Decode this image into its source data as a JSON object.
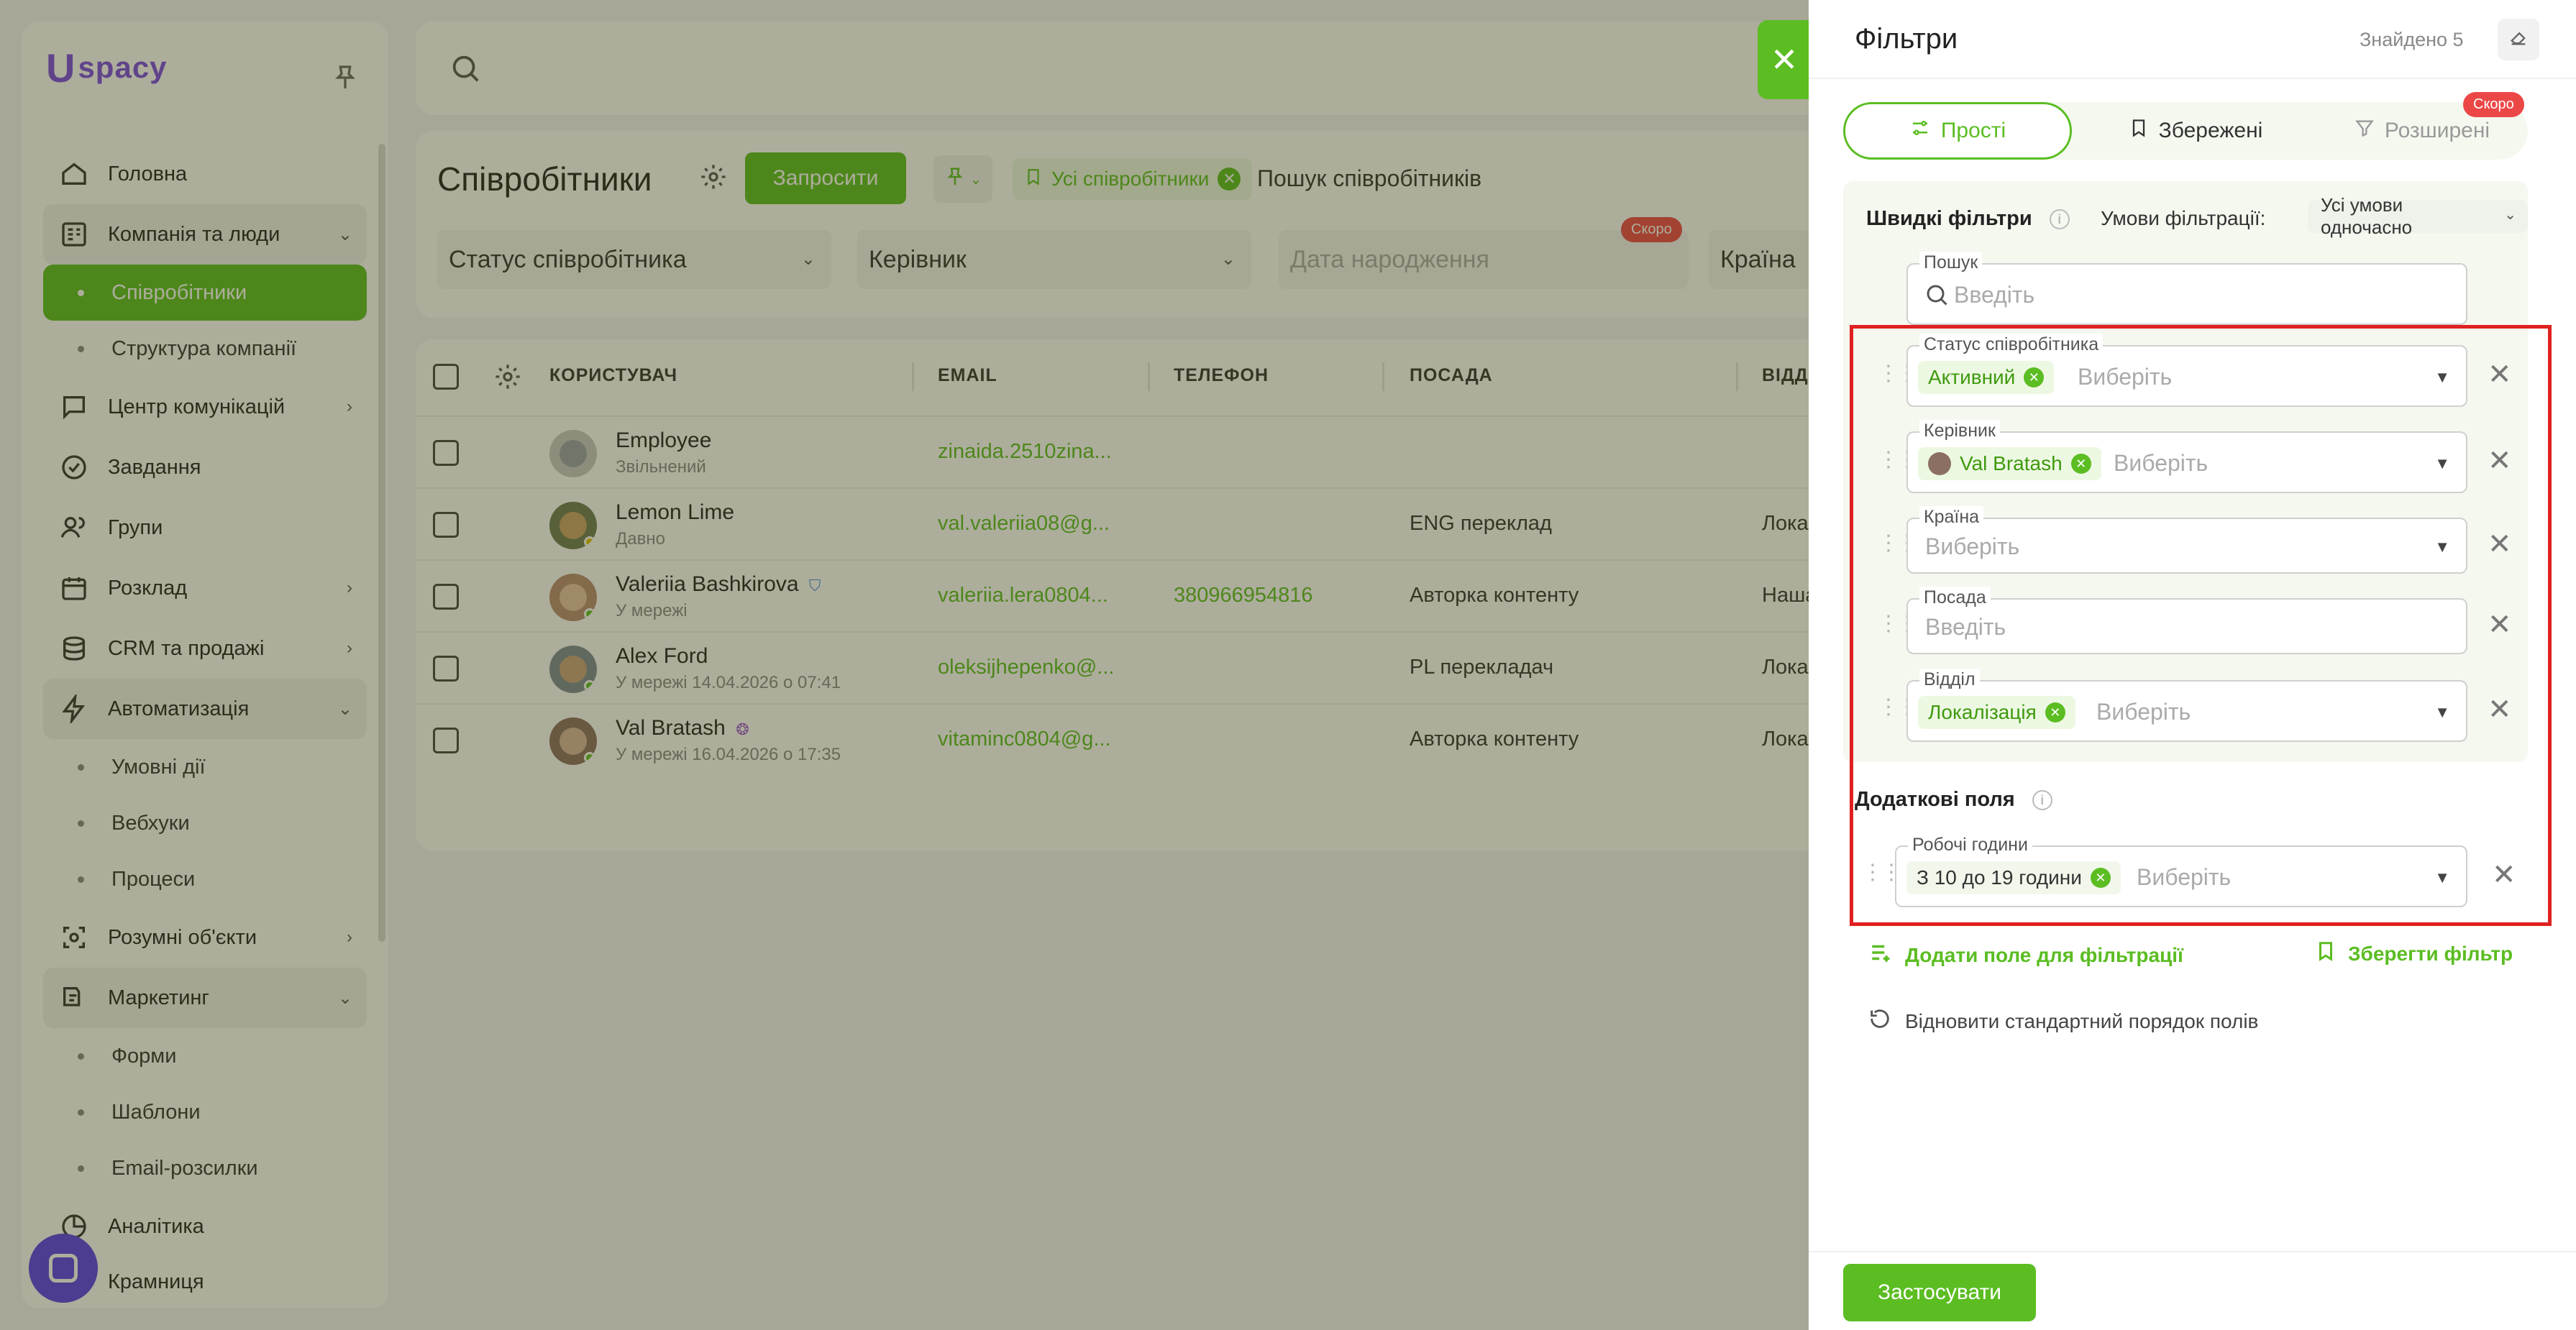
{
  "sidebar": {
    "logo_letter": "U",
    "logo_text": "spacy",
    "items": [
      {
        "label": "Головна",
        "icon": "home-icon"
      },
      {
        "label": "Компанія та люди",
        "icon": "building-icon",
        "chevron": "⌄"
      },
      {
        "label": "Співробітники",
        "sub": true,
        "active": true
      },
      {
        "label": "Структура компанії",
        "sub": true
      },
      {
        "label": "Центр комунікацій",
        "icon": "chat-icon",
        "chevron": "›"
      },
      {
        "label": "Завдання",
        "icon": "check-circle-icon"
      },
      {
        "label": "Групи",
        "icon": "users-icon"
      },
      {
        "label": "Розклад",
        "icon": "calendar-icon",
        "chevron": "›"
      },
      {
        "label": "CRM та продажі",
        "icon": "database-icon",
        "chevron": "›"
      },
      {
        "label": "Автоматизація",
        "icon": "bolt-icon",
        "chevron": "⌄"
      },
      {
        "label": "Умовні дії",
        "sub": true
      },
      {
        "label": "Вебхуки",
        "sub": true
      },
      {
        "label": "Процеси",
        "sub": true
      },
      {
        "label": "Розумні об'єкти",
        "icon": "scan-icon",
        "chevron": "›"
      },
      {
        "label": "Маркетинг",
        "icon": "megaphone-icon",
        "chevron": "⌄"
      },
      {
        "label": "Форми",
        "sub": true
      },
      {
        "label": "Шаблони",
        "sub": true
      },
      {
        "label": "Email-розсилки",
        "sub": true
      },
      {
        "label": "Аналітика",
        "icon": "chart-icon"
      },
      {
        "label": "Крамниця",
        "icon": "shop-icon"
      }
    ]
  },
  "header": {
    "page_title": "Співробітники",
    "invite_label": "Запросити",
    "chip_all": "Усі співробітники",
    "search_placeholder": "Пошук співробітників",
    "filters": [
      "Статус співробітника",
      "Керівник",
      "Дата народження",
      "Країна"
    ],
    "skoro": "Скоро"
  },
  "table": {
    "columns": [
      "КОРИСТУВАЧ",
      "EMAIL",
      "ТЕЛЕФОН",
      "ПОСАДА",
      "ВІДДІ"
    ],
    "rows": [
      {
        "name": "Employee",
        "sub": "Звільнений",
        "email": "zinaida.2510zina...",
        "phone": "",
        "position": "",
        "dept": ""
      },
      {
        "name": "Lemon Lime",
        "sub": "Давно",
        "email": "val.valeriia08@g...",
        "phone": "",
        "position": "ENG переклад",
        "dept": "Локаз"
      },
      {
        "name": "Valeriia Bashkirova",
        "sub": "У мережі",
        "email": "valeriia.lera0804...",
        "phone": "380966954816",
        "position": "Авторка контенту",
        "dept": "Наша к"
      },
      {
        "name": "Alex Ford",
        "sub": "У мережі 14.04.2026 о 07:41",
        "email": "oleksijhepenko@...",
        "phone": "",
        "position": "PL перекладач",
        "dept": "Локаз"
      },
      {
        "name": "Val Bratash",
        "sub": "У мережі 16.04.2026 о 17:35",
        "email": "vitaminc0804@g...",
        "phone": "",
        "position": "Авторка контенту",
        "dept": "Локаз"
      }
    ]
  },
  "drawer": {
    "title": "Фільтри",
    "found": "Знайдено 5",
    "tabs": {
      "simple": "Прості",
      "saved": "Збережені",
      "advanced": "Розширені",
      "skoro": "Скоро"
    },
    "quick_title": "Швидкі фільтри",
    "cond_label": "Умови фільтрації:",
    "cond_value": "Усі умови одночасно",
    "search_label": "Пошук",
    "search_placeholder": "Введіть",
    "status_label": "Статус співробітника",
    "status_tag": "Активний",
    "manager_label": "Керівник",
    "manager_tag": "Val Bratash",
    "country_label": "Країна",
    "position_label": "Посада",
    "dept_label": "Відділ",
    "dept_tag": "Локалізація",
    "select_placeholder": "Виберіть",
    "input_placeholder": "Введіть",
    "extra_title": "Додаткові поля",
    "hours_label": "Робочі години",
    "hours_tag": "З 10 до 19 години",
    "add_field": "Додати поле для фільтрації",
    "save_filter": "Зберегти фільтр",
    "reset_order": "Відновити стандартний порядок полів",
    "apply": "Застосувати"
  },
  "colors": {
    "accent": "#5bbd22",
    "highlight": "#e02020",
    "badge": "#ec4747",
    "brand": "#7b4be0"
  }
}
